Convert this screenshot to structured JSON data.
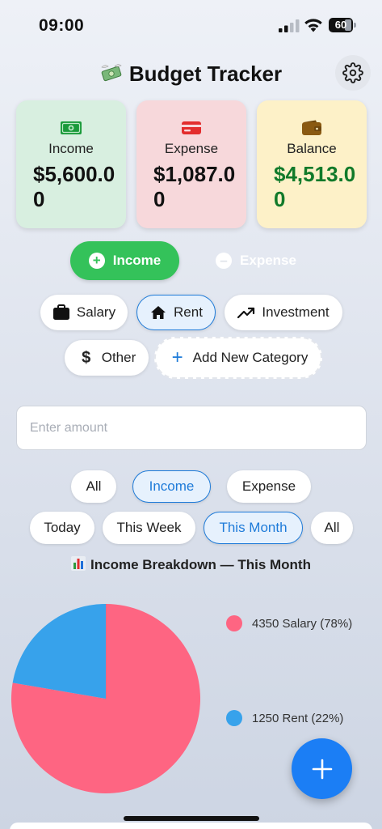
{
  "status": {
    "time": "09:00",
    "battery": "60"
  },
  "header": {
    "title": "Budget Tracker"
  },
  "summary": {
    "income": {
      "label": "Income",
      "amount": "$5,600.00"
    },
    "expense": {
      "label": "Expense",
      "amount": "$1,087.00"
    },
    "balance": {
      "label": "Balance",
      "amount": "$4,513.00"
    }
  },
  "type_toggle": {
    "income_label": "Income",
    "expense_label": "Expense"
  },
  "categories": {
    "salary": "Salary",
    "rent": "Rent",
    "investment": "Investment",
    "other": "Other",
    "add_new": "Add New Category"
  },
  "amount_input": {
    "placeholder": "Enter amount",
    "value": ""
  },
  "type_filter": {
    "all": "All",
    "income": "Income",
    "expense": "Expense"
  },
  "period_filter": {
    "today": "Today",
    "week": "This Week",
    "month": "This Month",
    "all": "All"
  },
  "chart_data": {
    "type": "pie",
    "title": "Income Breakdown — This Month",
    "categories": [
      "Salary",
      "Rent"
    ],
    "values": [
      4350,
      1250
    ],
    "percentages": [
      78,
      22
    ],
    "colors": [
      "#fe6582",
      "#37a2eb"
    ],
    "legend_labels": [
      "4350 Salary (78%)",
      "1250 Rent (22%)"
    ],
    "legend_position": "right"
  },
  "colors": {
    "accent": "#1b7ef5",
    "income_green": "#34c25a",
    "balance_text": "#117a2a",
    "selected_border": "#1e7bd9"
  },
  "icons": {
    "title": "money-with-wings-icon",
    "settings": "gear-icon",
    "income_card": "banknote-icon",
    "expense_card": "credit-card-icon",
    "balance_card": "wallet-icon",
    "fab": "plus-icon"
  }
}
